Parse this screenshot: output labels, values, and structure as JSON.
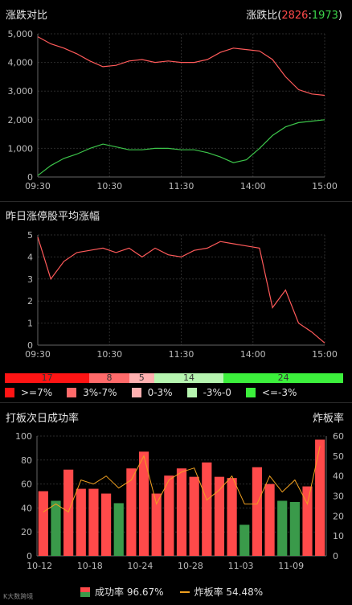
{
  "panel1": {
    "title": "涨跌对比",
    "ratio_label": "涨跌比(",
    "up_count": "2826",
    "sep": ":",
    "down_count": "1973",
    "close": ")"
  },
  "panel2": {
    "title": "昨日涨停股平均涨幅"
  },
  "distribution": {
    "segments": [
      {
        "value": "17",
        "color": "#ff1414"
      },
      {
        "value": "8",
        "color": "#ff6a6a"
      },
      {
        "value": "5",
        "color": "#ffb0b0"
      },
      {
        "value": "14",
        "color": "#b6f5b0"
      },
      {
        "value": "24",
        "color": "#3cf03c"
      }
    ],
    "legend": [
      {
        "label": ">=7%",
        "color": "#ff1414"
      },
      {
        "label": "3%-7%",
        "color": "#ff6a6a"
      },
      {
        "label": "0-3%",
        "color": "#ffb0b0"
      },
      {
        "label": "-3%-0",
        "color": "#b6f5b0"
      },
      {
        "label": "<=-3%",
        "color": "#3cf03c"
      }
    ]
  },
  "panel3": {
    "title": "打板次日成功率",
    "right_title": "炸板率",
    "legend_success": "成功率 96.67%",
    "legend_burst": "炸板率 54.48%"
  },
  "watermark": "K大数跨境",
  "chart_data": [
    {
      "type": "line",
      "title": "涨跌对比",
      "x_ticks": [
        "09:30",
        "10:30",
        "11:30",
        "14:00",
        "15:00"
      ],
      "y_ticks": [
        "0",
        "1,000",
        "2,000",
        "3,000",
        "4,000",
        "5,000"
      ],
      "ylim": [
        0,
        5000
      ],
      "series": [
        {
          "color": "#ff5a5a",
          "values": [
            4900,
            4650,
            4500,
            4300,
            4050,
            3850,
            3900,
            4050,
            4100,
            4000,
            4050,
            4000,
            4000,
            4100,
            4350,
            4500,
            4450,
            4400,
            4100,
            3500,
            3050,
            2900,
            2850
          ]
        },
        {
          "color": "#3cc44a",
          "values": [
            50,
            400,
            650,
            800,
            1000,
            1150,
            1050,
            950,
            950,
            1000,
            1000,
            950,
            950,
            850,
            700,
            500,
            600,
            1000,
            1450,
            1750,
            1900,
            1950,
            2000
          ]
        }
      ]
    },
    {
      "type": "line",
      "title": "昨日涨停股平均涨幅",
      "x_ticks": [
        "09:30",
        "10:30",
        "11:30",
        "14:00",
        "15:00"
      ],
      "y_ticks": [
        "0",
        "1",
        "2",
        "3",
        "4",
        "5"
      ],
      "ylim": [
        0,
        5
      ],
      "series": [
        {
          "color": "#ff5a5a",
          "values": [
            4.9,
            3.0,
            3.8,
            4.2,
            4.3,
            4.4,
            4.2,
            4.4,
            4.0,
            4.4,
            4.1,
            4.0,
            4.3,
            4.4,
            4.7,
            4.6,
            4.5,
            4.4,
            1.7,
            2.5,
            1.0,
            0.6,
            0.1
          ]
        }
      ]
    },
    {
      "type": "bar",
      "title": "打板次日成功率",
      "x_ticks": [
        "10-12",
        "10-18",
        "10-24",
        "10-28",
        "11-03",
        "11-09"
      ],
      "y_ticks": [
        "0",
        "20",
        "40",
        "60",
        "80",
        "100"
      ],
      "y2_ticks": [
        "0",
        "10",
        "20",
        "30",
        "40",
        "50",
        "60"
      ],
      "ylim": [
        0,
        100
      ],
      "y2lim": [
        0,
        60
      ],
      "series": [
        {
          "name": "成功率",
          "values": [
            54,
            46,
            72,
            56,
            56,
            52,
            44,
            73,
            87,
            52,
            67,
            73,
            66,
            78,
            66,
            65,
            26,
            74,
            60,
            46,
            45,
            58,
            97
          ]
        },
        {
          "name": "炸板率",
          "values": [
            22,
            26,
            22,
            38,
            36,
            40,
            34,
            38,
            50,
            26,
            38,
            42,
            44,
            28,
            33,
            40,
            26,
            26,
            40,
            32,
            38,
            26,
            55
          ]
        }
      ]
    }
  ]
}
